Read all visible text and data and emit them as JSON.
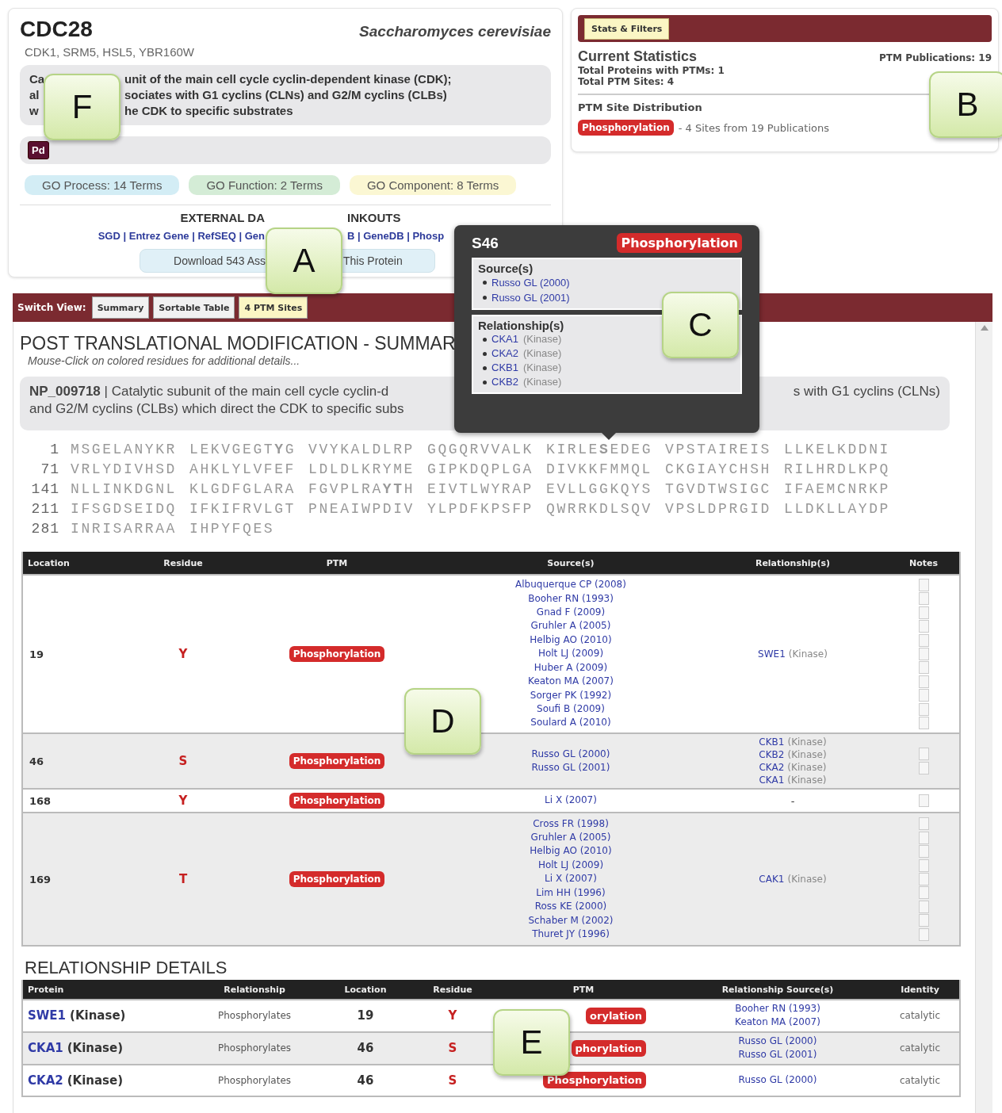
{
  "gene": {
    "symbol": "CDC28",
    "organism": "Saccharomyces cerevisiae",
    "synonyms": "CDK1, SRM5, HSL5, YBR160W",
    "description_lines": [
      [
        "Ca",
        "unit of the main cell cycle cyclin-dependent kinase (CDK);"
      ],
      [
        "al",
        "sociates with G1 cyclins (CLNs) and G2/M cyclins (CLBs)"
      ],
      [
        "w",
        "he CDK to specific substrates"
      ]
    ],
    "badge": "Pd",
    "go_terms": [
      {
        "label": "GO Process: 14 Terms",
        "color": "#d3edf5"
      },
      {
        "label": "GO Function: 2 Terms",
        "color": "#d4ecd6"
      },
      {
        "label": "GO Component: 8 Terms",
        "color": "#fbf7d3"
      }
    ],
    "linkouts_heading": [
      "EXTERNAL DA",
      "INKOUTS"
    ],
    "linkouts": [
      "SGD | Entrez Gene | RefSEQ | Gen",
      "B | GeneDB | Phosp"
    ],
    "download": [
      "Download 543 Ass",
      "This Protein"
    ]
  },
  "stats": {
    "tabs": [
      {
        "label": "Stats & Filters",
        "selected": true
      }
    ],
    "title": "Current Statistics",
    "publications": "PTM Publications: 19",
    "lines": [
      "Total Proteins with PTMs: 1",
      "Total PTM Sites: 4"
    ],
    "distribution_title": "PTM Site Distribution",
    "distribution": [
      {
        "ptm": "Phosphorylation",
        "text": "- 4 Sites from 19 Publications"
      }
    ]
  },
  "switch_view": {
    "label": "Switch View:",
    "buttons": [
      {
        "label": "Summary",
        "selected": false
      },
      {
        "label": "Sortable Table",
        "selected": false
      },
      {
        "label": "4 PTM Sites",
        "selected": true
      }
    ]
  },
  "summary": {
    "title": "POST TRANSLATIONAL MODIFICATION - SUMMAR",
    "hint": "Mouse-Click on colored residues for additional details...",
    "np_line1": [
      "**NP_009718** | Catalytic subunit of the main cell cycle cyclin-d",
      "s with G1 cyclins (CLNs)"
    ],
    "np_line2": "and G2/M cyclins (CLBs) which direct the CDK to specific subs",
    "sequence": [
      {
        "start": "1",
        "blocks": [
          "MSGELANYKR",
          "LEKVGEGT**Y**G",
          "VVYKALDLRP",
          "GQGQRVVALK",
          "KIRLE**S**EDEG",
          "VPSTAIREIS",
          "LLKELKDDNI"
        ]
      },
      {
        "start": "71",
        "blocks": [
          "VRLYDIVHSD",
          "AHKLYLVFEF",
          "LDLDLKRYME",
          "GIPKDQPLGA",
          "DIVKKFMMQL",
          "CKGIAYCHSH",
          "RILHRDLKPQ"
        ]
      },
      {
        "start": "141",
        "blocks": [
          "NLLINKDGNL",
          "KLGDFGLARA",
          "FGVPLRA**YT**H",
          "EIVTLWYRAP",
          "EVLLGGKQYS",
          "TGVDTWSIGC",
          "IFAEMCNRKP"
        ]
      },
      {
        "start": "211",
        "blocks": [
          "IFSGDSEIDQ",
          "IFKIFRVLGT",
          "PNEAIWPDIV",
          "YLPDFKPSFP",
          "QWRRKDLSQV",
          "VPSLDPRGID",
          "LLDKLLAYDP"
        ]
      },
      {
        "start": "281",
        "blocks": [
          "INRISARRAA",
          "IHPYFQES"
        ]
      }
    ]
  },
  "popup": {
    "site": "S46",
    "ptm": "Phosphorylation",
    "sources_title": "Source(s)",
    "sources": [
      "Russo GL (2000)",
      "Russo GL (2001)"
    ],
    "relationships_title": "Relationship(s)",
    "relationships": [
      {
        "name": "CKA1",
        "type": "(Kinase)"
      },
      {
        "name": "CKA2",
        "type": "(Kinase)"
      },
      {
        "name": "CKB1",
        "type": "(Kinase)"
      },
      {
        "name": "CKB2",
        "type": "(Kinase)"
      }
    ]
  },
  "ptm_table": {
    "columns": [
      "Location",
      "Residue",
      "PTM",
      "Source(s)",
      "Relationship(s)",
      "Notes"
    ],
    "rows": [
      {
        "location": "19",
        "residue": "Y",
        "ptm": "Phosphorylation",
        "sources": [
          {
            "source": "Albuquerque CP (2008)",
            "note_checked": false
          },
          {
            "source": "Booher RN (1993)",
            "note_checked": false
          },
          {
            "source": "Gnad F (2009)",
            "note_checked": false
          },
          {
            "source": "Gruhler A (2005)",
            "note_checked": false
          },
          {
            "source": "Helbig AO (2010)",
            "note_checked": false
          },
          {
            "source": "Holt LJ (2009)",
            "note_checked": false
          },
          {
            "source": "Huber A (2009)",
            "note_checked": false
          },
          {
            "source": "Keaton MA (2007)",
            "note_checked": false
          },
          {
            "source": "Sorger PK (1992)",
            "note_checked": false
          },
          {
            "source": "Soufi B (2009)",
            "note_checked": false
          },
          {
            "source": "Soulard A (2010)",
            "note_checked": false
          }
        ],
        "relationships": [
          {
            "name": "SWE1",
            "type": "(Kinase)"
          }
        ]
      },
      {
        "location": "46",
        "residue": "S",
        "ptm": "Phosphorylation",
        "sources": [
          {
            "source": "Russo GL (2000)",
            "note_checked": false
          },
          {
            "source": "Russo GL (2001)",
            "note_checked": false
          }
        ],
        "relationships": [
          {
            "name": "CKB1",
            "type": "(Kinase)"
          },
          {
            "name": "CKB2",
            "type": "(Kinase)"
          },
          {
            "name": "CKA2",
            "type": "(Kinase)"
          },
          {
            "name": "CKA1",
            "type": "(Kinase)"
          }
        ]
      },
      {
        "location": "168",
        "residue": "Y",
        "ptm": "Phosphorylation",
        "sources": [
          {
            "source": "Li X (2007)",
            "note_checked": false
          }
        ],
        "relationship_none": "-"
      },
      {
        "location": "169",
        "residue": "T",
        "ptm": "Phosphorylation",
        "sources": [
          {
            "source": "Cross FR (1998)",
            "note_checked": false
          },
          {
            "source": "Gruhler A (2005)",
            "note_checked": false
          },
          {
            "source": "Helbig AO (2010)",
            "note_checked": false
          },
          {
            "source": "Holt LJ (2009)",
            "note_checked": false
          },
          {
            "source": "Li X (2007)",
            "note_checked": false
          },
          {
            "source": "Lim HH (1996)",
            "note_checked": false
          },
          {
            "source": "Ross KE (2000)",
            "note_checked": false
          },
          {
            "source": "Schaber M (2002)",
            "note_checked": false
          },
          {
            "source": "Thuret JY (1996)",
            "note_checked": false
          }
        ],
        "relationships": [
          {
            "name": "CAK1",
            "type": "(Kinase)"
          }
        ]
      }
    ]
  },
  "relationship_details": {
    "title": "RELATIONSHIP DETAILS",
    "columns": [
      "Protein",
      "Relationship",
      "Location",
      "Residue",
      "PTM",
      "Relationship Source(s)",
      "Identity"
    ],
    "rows": [
      {
        "protein": "SWE1",
        "type": "(Kinase)",
        "relationship": "Phosphorylates",
        "location": "19",
        "residue": "Y",
        "ptm": "orylation",
        "sources": [
          "Booher RN (1993)",
          "Keaton MA (2007)"
        ],
        "identity": "catalytic"
      },
      {
        "protein": "CKA1",
        "type": "(Kinase)",
        "relationship": "Phosphorylates",
        "location": "46",
        "residue": "S",
        "ptm": "phorylation",
        "sources": [
          "Russo GL (2000)",
          "Russo GL (2001)"
        ],
        "identity": "catalytic"
      },
      {
        "protein": "CKA2",
        "type": "(Kinase)",
        "relationship": "Phosphorylates",
        "location": "46",
        "residue": "S",
        "ptm": "Phosphorylation",
        "sources": [
          "Russo GL (2000)"
        ],
        "identity": "catalytic"
      }
    ]
  },
  "callouts": [
    {
      "label": "F"
    },
    {
      "label": "A"
    },
    {
      "label": "B"
    },
    {
      "label": "C"
    },
    {
      "label": "D"
    },
    {
      "label": "E"
    }
  ]
}
